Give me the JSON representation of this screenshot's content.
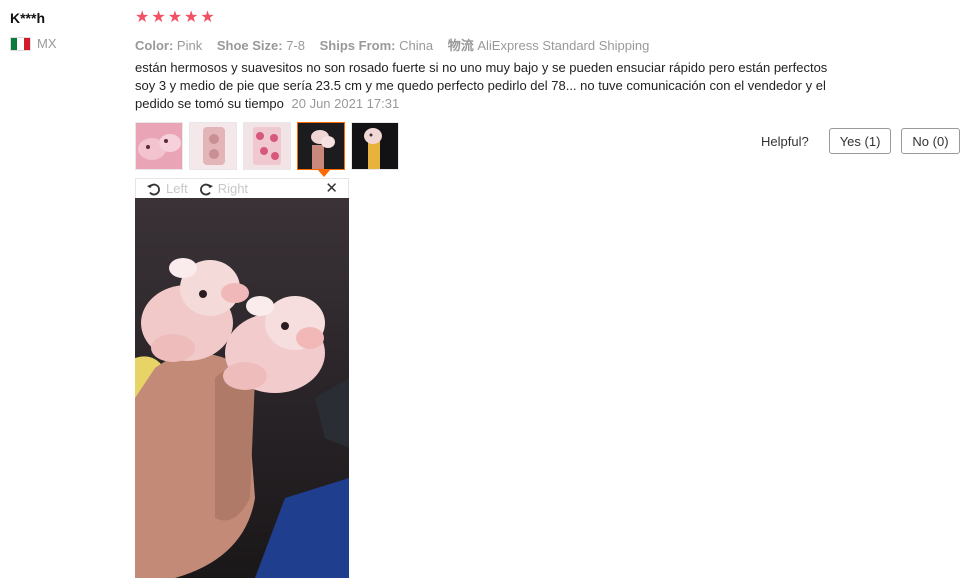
{
  "review": {
    "user_name": "K***h",
    "country_code": "MX",
    "rating": 5,
    "star_glyph": "★",
    "attributes": [
      {
        "key": "Color:",
        "value": "Pink"
      },
      {
        "key": "Shoe Size:",
        "value": "7-8"
      },
      {
        "key": "Ships From:",
        "value": "China"
      },
      {
        "key": "物流",
        "value": "AliExpress Standard Shipping"
      }
    ],
    "text": "están hermosos y suavesitos no son rosado fuerte si no uno muy bajo y se pueden ensuciar rápido pero están perfectos soy 3 y medio de pie que sería 23.5 cm y me quedo perfecto pedirlo del 78... no tuve comunicación con el vendedor y el pedido se tomó su tiempo",
    "date": "20 Jun 2021 17:31",
    "photos_count": 5,
    "active_photo": 4
  },
  "viewer": {
    "rotate_left_label": "Left",
    "rotate_right_label": "Right",
    "close_glyph": "✕"
  },
  "helpful": {
    "label": "Helpful?",
    "yes_label": "Yes (1)",
    "no_label": "No (0)"
  },
  "colors": {
    "star": "#f25064",
    "active_border": "#ff6a00"
  }
}
